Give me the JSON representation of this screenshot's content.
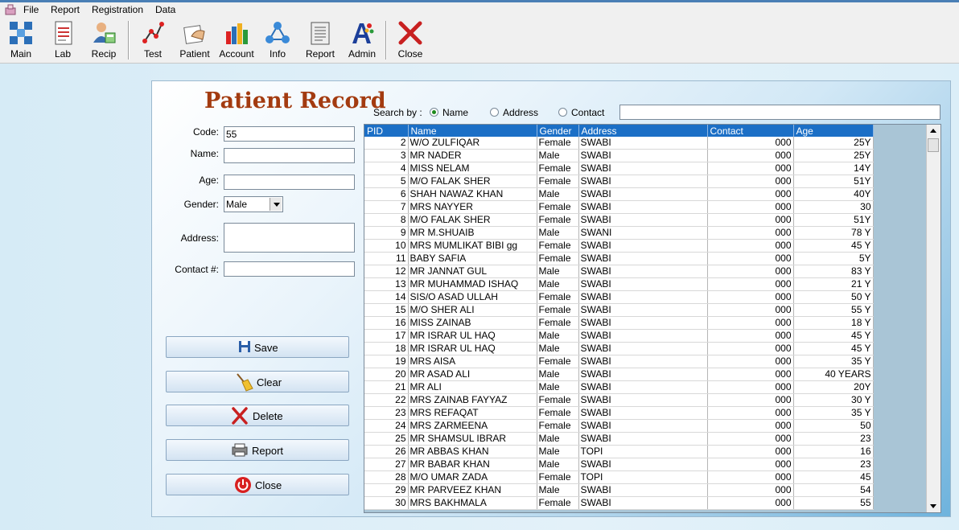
{
  "menu": {
    "items": [
      "File",
      "Report",
      "Registration",
      "Data"
    ]
  },
  "toolbar": {
    "buttons": [
      "Main",
      "Lab",
      "Recip",
      "Test",
      "Patient",
      "Account",
      "Info",
      "Report",
      "Admin",
      "Close"
    ]
  },
  "form": {
    "title": "Patient Record",
    "labels": {
      "code": "Code:",
      "name": "Name:",
      "age": "Age:",
      "gender": "Gender:",
      "address": "Address:",
      "contact": "Contact #:"
    },
    "values": {
      "code": "55",
      "name": "",
      "age": "",
      "gender": "Male",
      "address": "",
      "contact": ""
    },
    "buttons": {
      "save": "Save",
      "clear": "Clear",
      "delete": "Delete",
      "report": "Report",
      "close": "Close"
    }
  },
  "search": {
    "label": "Search by :",
    "options": [
      "Name",
      "Address",
      "Contact"
    ],
    "selected": "Name",
    "value": ""
  },
  "grid": {
    "columns": [
      "PID",
      "Name",
      "Gender",
      "Address",
      "Contact",
      "Age"
    ],
    "rows": [
      [
        "2",
        "W/O ZULFIQAR",
        "Female",
        "SWABI",
        "000",
        "25Y"
      ],
      [
        "3",
        "MR NADER",
        "Male",
        "SWABI",
        "000",
        "25Y"
      ],
      [
        "4",
        "MISS NELAM",
        "Female",
        "SWABI",
        "000",
        "14Y"
      ],
      [
        "5",
        "M/O FALAK SHER",
        "Female",
        "SWABI",
        "000",
        "51Y"
      ],
      [
        "6",
        "SHAH NAWAZ KHAN",
        "Male",
        "SWABI",
        "000",
        "40Y"
      ],
      [
        "7",
        "MRS NAYYER",
        "Female",
        "SWABI",
        "000",
        "30"
      ],
      [
        "8",
        "M/O FALAK SHER",
        "Female",
        "SWABI",
        "000",
        "51Y"
      ],
      [
        "9",
        "MR M.SHUAIB",
        "Male",
        "SWANI",
        "000",
        "78 Y"
      ],
      [
        "10",
        "MRS MUMLIKAT BIBI gg",
        "Female",
        "SWABI",
        "000",
        "45 Y"
      ],
      [
        "11",
        "BABY SAFIA",
        "Female",
        "SWABI",
        "000",
        "5Y"
      ],
      [
        "12",
        "MR JANNAT GUL",
        "Male",
        "SWABI",
        "000",
        "83 Y"
      ],
      [
        "13",
        "MR MUHAMMAD ISHAQ",
        "Male",
        "SWABI",
        "000",
        "21 Y"
      ],
      [
        "14",
        "SIS/O ASAD ULLAH",
        "Female",
        "SWABI",
        "000",
        "50 Y"
      ],
      [
        "15",
        "M/O SHER ALI",
        "Female",
        "SWABI",
        "000",
        "55 Y"
      ],
      [
        "16",
        "MISS ZAINAB",
        "Female",
        "SWABI",
        "000",
        "18 Y"
      ],
      [
        "17",
        "MR ISRAR UL HAQ",
        "Male",
        "SWABI",
        "000",
        "45 Y"
      ],
      [
        "18",
        "MR ISRAR UL HAQ",
        "Male",
        "SWABI",
        "000",
        "45 Y"
      ],
      [
        "19",
        "MRS AISA",
        "Female",
        "SWABI",
        "000",
        "35 Y"
      ],
      [
        "20",
        "MR ASAD ALI",
        "Male",
        "SWABI",
        "000",
        "40 YEARS"
      ],
      [
        "21",
        "MR ALI",
        "Male",
        "SWABI",
        "000",
        "20Y"
      ],
      [
        "22",
        "MRS ZAINAB FAYYAZ",
        "Female",
        "SWABI",
        "000",
        "30 Y"
      ],
      [
        "23",
        "MRS REFAQAT",
        "Female",
        "SWABI",
        "000",
        "35 Y"
      ],
      [
        "24",
        "MRS ZARMEENA",
        "Female",
        "SWABI",
        "000",
        "50"
      ],
      [
        "25",
        "MR SHAMSUL IBRAR",
        "Male",
        "SWABI",
        "000",
        "23"
      ],
      [
        "26",
        "MR ABBAS KHAN",
        "Male",
        "TOPI",
        "000",
        "16"
      ],
      [
        "27",
        "MR BABAR KHAN",
        "Male",
        "SWABI",
        "000",
        "23"
      ],
      [
        "28",
        "M/O UMAR ZADA",
        "Female",
        "TOPI",
        "000",
        "45"
      ],
      [
        "29",
        "MR PARVEEZ KHAN",
        "Male",
        "SWABI",
        "000",
        "54"
      ],
      [
        "30",
        "MRS BAKHMALA",
        "Female",
        "SWABI",
        "000",
        "55"
      ]
    ]
  },
  "colors": {
    "title": "#a33b10",
    "grid_header": "#1b6fc6"
  }
}
